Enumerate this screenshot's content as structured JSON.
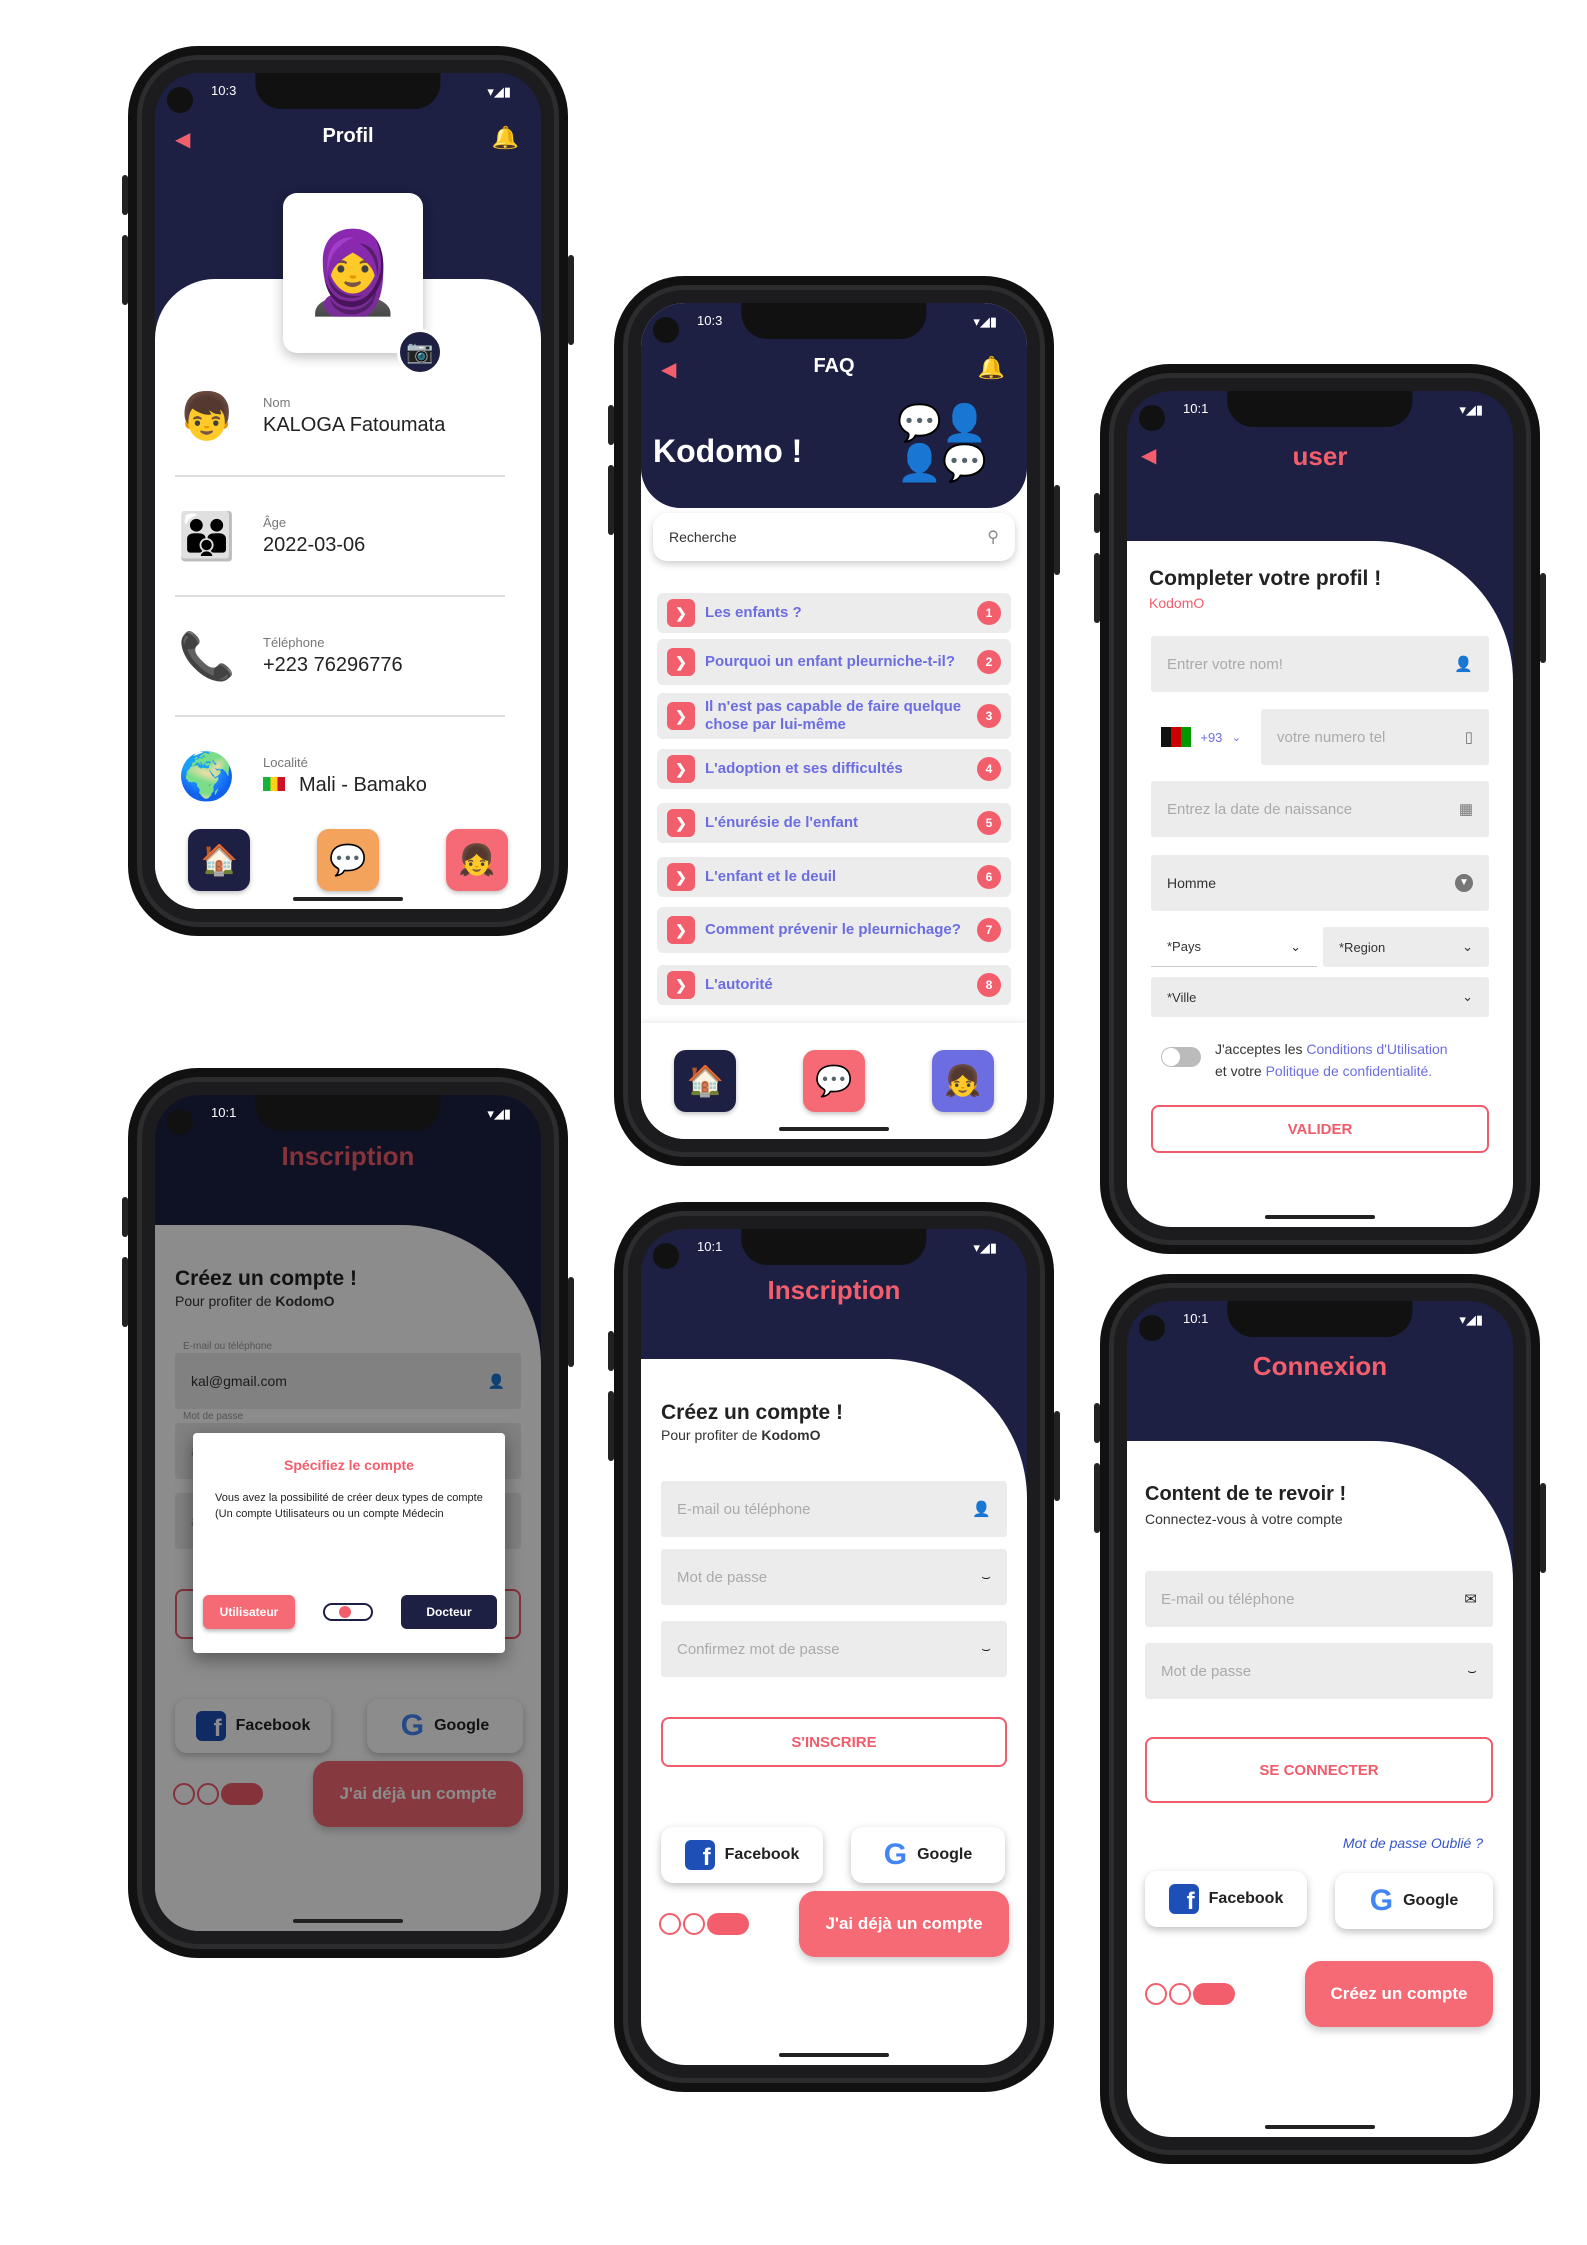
{
  "status_time": "10:3",
  "status_time_b": "10:1",
  "profile": {
    "title": "Profil",
    "fields": [
      {
        "label": "Nom",
        "value": "KALOGA Fatoumata"
      },
      {
        "label": "Âge",
        "value": "2022-03-06"
      },
      {
        "label": "Téléphone",
        "value": "+223 76296776"
      },
      {
        "label": "Localité",
        "value": "Mali - Bamako"
      }
    ]
  },
  "faq": {
    "title": "FAQ",
    "brand": "Kodomo !",
    "search_placeholder": "Recherche",
    "items": [
      {
        "label": "Les enfants ?",
        "n": "1"
      },
      {
        "label": "Pourquoi un enfant pleurniche-t-il?",
        "n": "2"
      },
      {
        "label": "Il n'est pas capable de faire quelque chose par lui-même",
        "n": "3"
      },
      {
        "label": "L'adoption et ses difficultés",
        "n": "4"
      },
      {
        "label": "L'énurésie de l'enfant",
        "n": "5"
      },
      {
        "label": "L'enfant et le deuil",
        "n": "6"
      },
      {
        "label": "Comment prévenir le pleurnichage?",
        "n": "7"
      },
      {
        "label": "L'autorité",
        "n": "8"
      }
    ]
  },
  "user": {
    "title": "user",
    "heading": "Completer votre profil !",
    "brand": "KodomO",
    "name_ph": "Entrer votre nom!",
    "dial": "+93",
    "phone_ph": "votre numero tel",
    "dob_ph": "Entrez la date de naissance",
    "gender": "Homme",
    "country": "*Pays",
    "region": "*Region",
    "city": "*Ville",
    "terms_1": "J'acceptes les ",
    "terms_link1": "Conditions d'Utilisation",
    "terms_2": "et votre ",
    "terms_link2": "Politique de confidentialité.",
    "submit": "VALIDER"
  },
  "inscription_modal": {
    "title": "Inscription",
    "heading": "Créez un compte !",
    "sub": "Pour profiter de ",
    "brand": "KodomO",
    "email_label": "E-mail ou téléphone",
    "email_value": "kal@gmail.com",
    "pwd_label": "Mot de passe",
    "modal_title": "Spécifiez le compte",
    "modal_text": "Vous avez la possibilité de créer deux types de compte (Un compte Utilisateurs ou un compte Médecin",
    "btn_user": "Utilisateur",
    "btn_doc": "Docteur",
    "facebook": "Facebook",
    "google": "Google",
    "already": "J'ai déjà un compte"
  },
  "inscription": {
    "title": "Inscription",
    "heading": "Créez un compte !",
    "sub": "Pour profiter de ",
    "brand": "KodomO",
    "email_ph": "E-mail ou téléphone",
    "pwd_ph": "Mot de passe",
    "confirm_ph": "Confirmez mot de passe",
    "submit": "S'INSCRIRE",
    "facebook": "Facebook",
    "google": "Google",
    "already": "J'ai déjà un compte"
  },
  "connexion": {
    "title": "Connexion",
    "heading": "Content de te revoir !",
    "sub": "Connectez-vous à votre compte",
    "email_ph": "E-mail ou téléphone",
    "pwd_ph": "Mot de passe",
    "submit": "SE CONNECTER",
    "forgot": "Mot de passe Oublié ?",
    "facebook": "Facebook",
    "google": "Google",
    "create": "Créez un compte"
  },
  "colors": {
    "navy": "#1d1f43",
    "accent": "#f25e6c",
    "link": "#6b6de0"
  }
}
